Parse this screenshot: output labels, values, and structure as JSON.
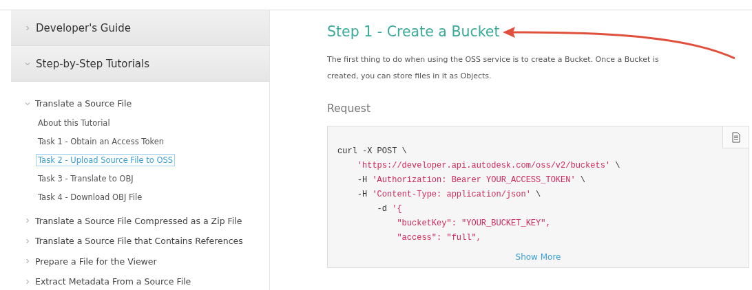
{
  "sidebar": {
    "sections": [
      {
        "label": "Developer's Guide",
        "expanded": false
      },
      {
        "label": "Step-by-Step Tutorials",
        "expanded": true,
        "children": [
          {
            "label": "Translate a Source File",
            "expanded": true,
            "children": [
              {
                "label": "About this Tutorial",
                "selected": false
              },
              {
                "label": "Task 1 - Obtain an Access Token",
                "selected": false
              },
              {
                "label": "Task 2 - Upload Source File to OSS",
                "selected": true
              },
              {
                "label": "Task 3 - Translate to OBJ",
                "selected": false
              },
              {
                "label": "Task 4 - Download OBJ File",
                "selected": false
              }
            ]
          },
          {
            "label": "Translate a Source File Compressed as a Zip File",
            "expanded": false
          },
          {
            "label": "Translate a Source File that Contains References",
            "expanded": false
          },
          {
            "label": "Prepare a File for the Viewer",
            "expanded": false
          },
          {
            "label": "Extract Metadata From a Source File",
            "expanded": false
          }
        ]
      }
    ]
  },
  "main": {
    "title": "Step 1 - Create a Bucket",
    "intro": "The first thing to do when using the OSS service is to create a Bucket. Once a Bucket is created, you can store files in it as Objects.",
    "subheading": "Request",
    "code": {
      "lines": [
        {
          "parts": [
            {
              "kind": "plain",
              "text": "curl -X POST \\"
            }
          ]
        },
        {
          "parts": [
            {
              "kind": "string",
              "text": "    'https://developer.api.autodesk.com/oss/v2/buckets'"
            },
            {
              "kind": "plain",
              "text": " \\"
            }
          ]
        },
        {
          "parts": [
            {
              "kind": "plain",
              "text": "    -H "
            },
            {
              "kind": "string",
              "text": "'Authorization: Bearer YOUR_ACCESS_TOKEN'"
            },
            {
              "kind": "plain",
              "text": " \\"
            }
          ]
        },
        {
          "parts": [
            {
              "kind": "plain",
              "text": "    -H "
            },
            {
              "kind": "string",
              "text": "'Content-Type: application/json'"
            },
            {
              "kind": "plain",
              "text": " \\"
            }
          ]
        },
        {
          "parts": [
            {
              "kind": "plain",
              "text": "        -d "
            },
            {
              "kind": "string",
              "text": "'{"
            }
          ]
        },
        {
          "parts": [
            {
              "kind": "string",
              "text": "            \"bucketKey\": \"YOUR_BUCKET_KEY\","
            }
          ]
        },
        {
          "parts": [
            {
              "kind": "string",
              "text": "            \"access\": \"full\","
            }
          ]
        }
      ],
      "show_more": "Show More"
    }
  }
}
